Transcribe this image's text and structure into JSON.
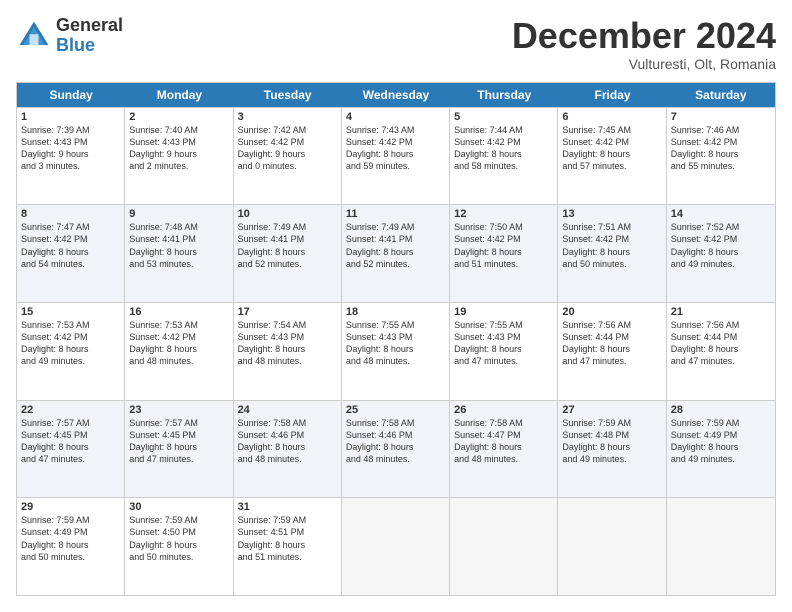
{
  "logo": {
    "general": "General",
    "blue": "Blue"
  },
  "title": "December 2024",
  "location": "Vulturesti, Olt, Romania",
  "header_days": [
    "Sunday",
    "Monday",
    "Tuesday",
    "Wednesday",
    "Thursday",
    "Friday",
    "Saturday"
  ],
  "weeks": [
    [
      {
        "day": "1",
        "lines": [
          "Sunrise: 7:39 AM",
          "Sunset: 4:43 PM",
          "Daylight: 9 hours",
          "and 3 minutes."
        ]
      },
      {
        "day": "2",
        "lines": [
          "Sunrise: 7:40 AM",
          "Sunset: 4:43 PM",
          "Daylight: 9 hours",
          "and 2 minutes."
        ]
      },
      {
        "day": "3",
        "lines": [
          "Sunrise: 7:42 AM",
          "Sunset: 4:42 PM",
          "Daylight: 9 hours",
          "and 0 minutes."
        ]
      },
      {
        "day": "4",
        "lines": [
          "Sunrise: 7:43 AM",
          "Sunset: 4:42 PM",
          "Daylight: 8 hours",
          "and 59 minutes."
        ]
      },
      {
        "day": "5",
        "lines": [
          "Sunrise: 7:44 AM",
          "Sunset: 4:42 PM",
          "Daylight: 8 hours",
          "and 58 minutes."
        ]
      },
      {
        "day": "6",
        "lines": [
          "Sunrise: 7:45 AM",
          "Sunset: 4:42 PM",
          "Daylight: 8 hours",
          "and 57 minutes."
        ]
      },
      {
        "day": "7",
        "lines": [
          "Sunrise: 7:46 AM",
          "Sunset: 4:42 PM",
          "Daylight: 8 hours",
          "and 55 minutes."
        ]
      }
    ],
    [
      {
        "day": "8",
        "lines": [
          "Sunrise: 7:47 AM",
          "Sunset: 4:42 PM",
          "Daylight: 8 hours",
          "and 54 minutes."
        ]
      },
      {
        "day": "9",
        "lines": [
          "Sunrise: 7:48 AM",
          "Sunset: 4:41 PM",
          "Daylight: 8 hours",
          "and 53 minutes."
        ]
      },
      {
        "day": "10",
        "lines": [
          "Sunrise: 7:49 AM",
          "Sunset: 4:41 PM",
          "Daylight: 8 hours",
          "and 52 minutes."
        ]
      },
      {
        "day": "11",
        "lines": [
          "Sunrise: 7:49 AM",
          "Sunset: 4:41 PM",
          "Daylight: 8 hours",
          "and 52 minutes."
        ]
      },
      {
        "day": "12",
        "lines": [
          "Sunrise: 7:50 AM",
          "Sunset: 4:42 PM",
          "Daylight: 8 hours",
          "and 51 minutes."
        ]
      },
      {
        "day": "13",
        "lines": [
          "Sunrise: 7:51 AM",
          "Sunset: 4:42 PM",
          "Daylight: 8 hours",
          "and 50 minutes."
        ]
      },
      {
        "day": "14",
        "lines": [
          "Sunrise: 7:52 AM",
          "Sunset: 4:42 PM",
          "Daylight: 8 hours",
          "and 49 minutes."
        ]
      }
    ],
    [
      {
        "day": "15",
        "lines": [
          "Sunrise: 7:53 AM",
          "Sunset: 4:42 PM",
          "Daylight: 8 hours",
          "and 49 minutes."
        ]
      },
      {
        "day": "16",
        "lines": [
          "Sunrise: 7:53 AM",
          "Sunset: 4:42 PM",
          "Daylight: 8 hours",
          "and 48 minutes."
        ]
      },
      {
        "day": "17",
        "lines": [
          "Sunrise: 7:54 AM",
          "Sunset: 4:43 PM",
          "Daylight: 8 hours",
          "and 48 minutes."
        ]
      },
      {
        "day": "18",
        "lines": [
          "Sunrise: 7:55 AM",
          "Sunset: 4:43 PM",
          "Daylight: 8 hours",
          "and 48 minutes."
        ]
      },
      {
        "day": "19",
        "lines": [
          "Sunrise: 7:55 AM",
          "Sunset: 4:43 PM",
          "Daylight: 8 hours",
          "and 47 minutes."
        ]
      },
      {
        "day": "20",
        "lines": [
          "Sunrise: 7:56 AM",
          "Sunset: 4:44 PM",
          "Daylight: 8 hours",
          "and 47 minutes."
        ]
      },
      {
        "day": "21",
        "lines": [
          "Sunrise: 7:56 AM",
          "Sunset: 4:44 PM",
          "Daylight: 8 hours",
          "and 47 minutes."
        ]
      }
    ],
    [
      {
        "day": "22",
        "lines": [
          "Sunrise: 7:57 AM",
          "Sunset: 4:45 PM",
          "Daylight: 8 hours",
          "and 47 minutes."
        ]
      },
      {
        "day": "23",
        "lines": [
          "Sunrise: 7:57 AM",
          "Sunset: 4:45 PM",
          "Daylight: 8 hours",
          "and 47 minutes."
        ]
      },
      {
        "day": "24",
        "lines": [
          "Sunrise: 7:58 AM",
          "Sunset: 4:46 PM",
          "Daylight: 8 hours",
          "and 48 minutes."
        ]
      },
      {
        "day": "25",
        "lines": [
          "Sunrise: 7:58 AM",
          "Sunset: 4:46 PM",
          "Daylight: 8 hours",
          "and 48 minutes."
        ]
      },
      {
        "day": "26",
        "lines": [
          "Sunrise: 7:58 AM",
          "Sunset: 4:47 PM",
          "Daylight: 8 hours",
          "and 48 minutes."
        ]
      },
      {
        "day": "27",
        "lines": [
          "Sunrise: 7:59 AM",
          "Sunset: 4:48 PM",
          "Daylight: 8 hours",
          "and 49 minutes."
        ]
      },
      {
        "day": "28",
        "lines": [
          "Sunrise: 7:59 AM",
          "Sunset: 4:49 PM",
          "Daylight: 8 hours",
          "and 49 minutes."
        ]
      }
    ],
    [
      {
        "day": "29",
        "lines": [
          "Sunrise: 7:59 AM",
          "Sunset: 4:49 PM",
          "Daylight: 8 hours",
          "and 50 minutes."
        ]
      },
      {
        "day": "30",
        "lines": [
          "Sunrise: 7:59 AM",
          "Sunset: 4:50 PM",
          "Daylight: 8 hours",
          "and 50 minutes."
        ]
      },
      {
        "day": "31",
        "lines": [
          "Sunrise: 7:59 AM",
          "Sunset: 4:51 PM",
          "Daylight: 8 hours",
          "and 51 minutes."
        ]
      },
      {
        "day": "",
        "lines": []
      },
      {
        "day": "",
        "lines": []
      },
      {
        "day": "",
        "lines": []
      },
      {
        "day": "",
        "lines": []
      }
    ]
  ]
}
